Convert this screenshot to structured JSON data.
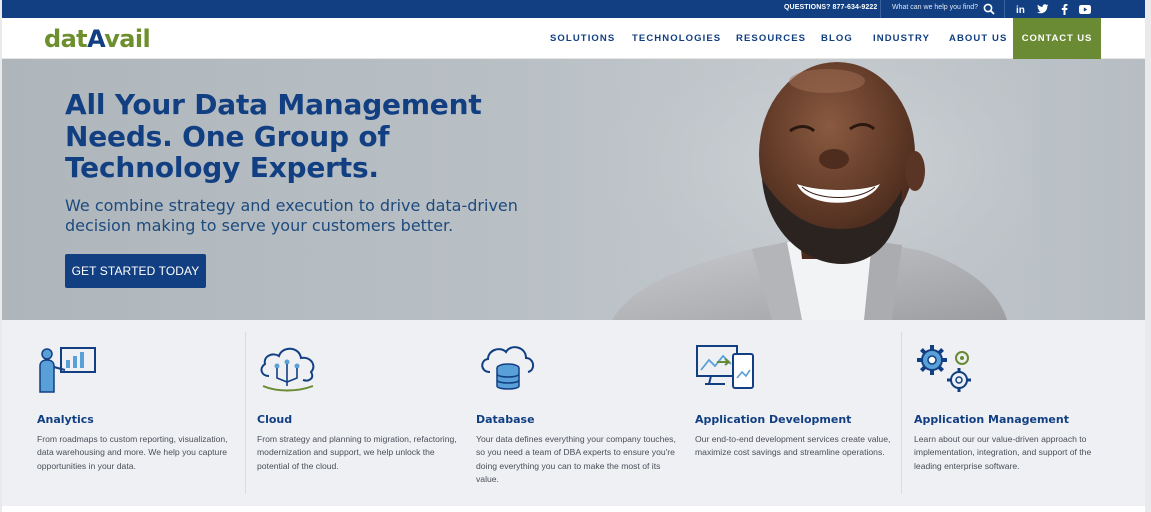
{
  "topbar": {
    "questions": "QUESTIONS? 877-634-9222",
    "search_placeholder": "What can we help you find?",
    "social": [
      "linkedin-icon",
      "twitter-icon",
      "facebook-icon",
      "youtube-icon"
    ]
  },
  "header": {
    "logo_part1": "dat",
    "logo_part2": "Avail",
    "nav": [
      "SOLUTIONS",
      "TECHNOLOGIES",
      "RESOURCES",
      "BLOG",
      "INDUSTRY",
      "ABOUT US"
    ],
    "contact": "CONTACT US"
  },
  "hero": {
    "title": "All Your Data Management Needs. One Group of Technology Experts.",
    "subtitle": "We combine strategy and execution to drive data-driven decision making to serve your customers better.",
    "cta": "GET STARTED TODAY"
  },
  "services": [
    {
      "title": "Analytics",
      "desc": "From roadmaps to custom reporting, visualization, data warehousing and more. We help you capture opportunities in your data.",
      "icon": "analytics-icon"
    },
    {
      "title": "Cloud",
      "desc": "From strategy and planning to migration, refactoring, modernization and support, we help unlock the potential of the cloud.",
      "icon": "cloud-icon"
    },
    {
      "title": "Database",
      "desc": "Your data defines everything your company touches, so you need a team of DBA experts to ensure you're doing everything you can to make the most of its value.",
      "icon": "database-icon"
    },
    {
      "title": "Application Development",
      "desc": "Our end-to-end development services create value, maximize cost savings and streamline operations.",
      "icon": "app-development-icon"
    },
    {
      "title": "Application Management",
      "desc": "Learn about our our value-driven approach to implementation, integration, and support of the leading enterprise software.",
      "icon": "app-management-icon"
    }
  ],
  "colors": {
    "brand_blue": "#123f82",
    "brand_green": "#6a8a34",
    "hero_bg": "#b9c0c5",
    "services_bg": "#eef0f4"
  }
}
